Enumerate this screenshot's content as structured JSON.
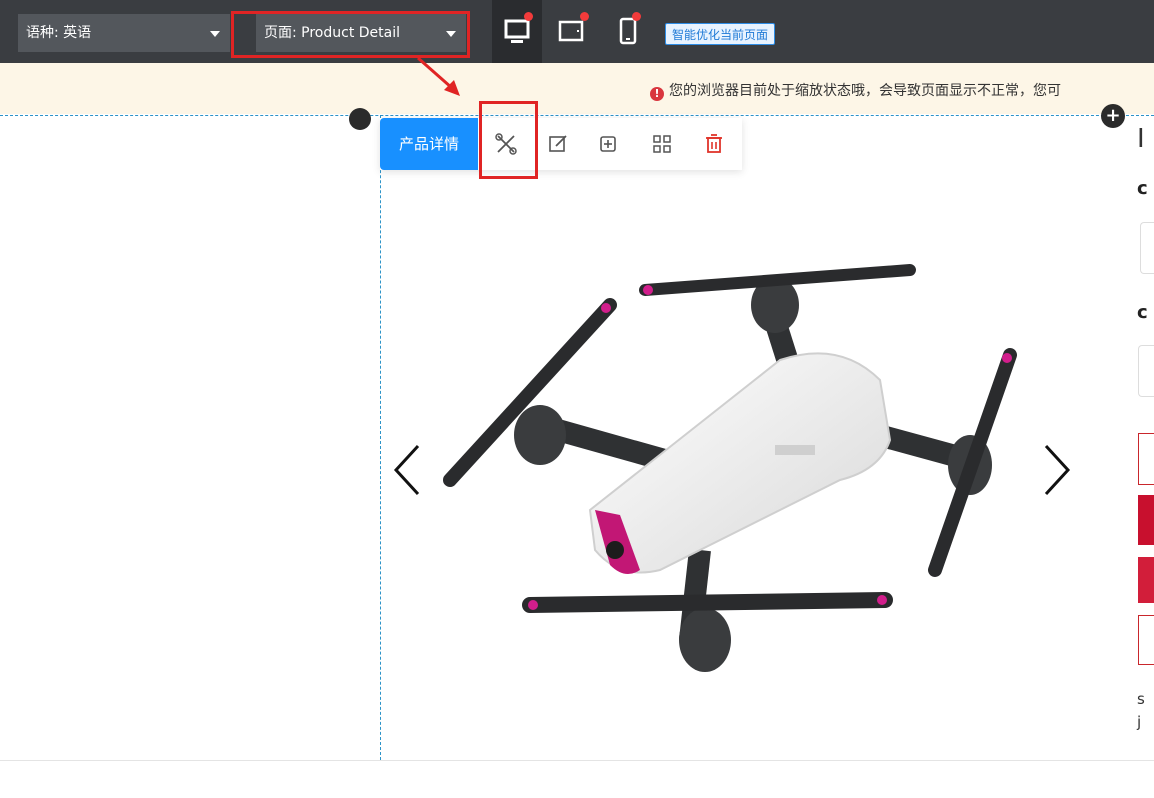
{
  "topbar": {
    "language_label": "语种: 英语",
    "page_label": "页面: Product Detail",
    "devices": [
      "desktop",
      "tablet",
      "mobile"
    ],
    "optimize_button": "智能优化当前页面"
  },
  "warning": {
    "text": "您的浏览器目前处于缩放状态哦，会导致页面显示不正常，您可"
  },
  "module_toolbar": {
    "label": "产品详情",
    "actions": [
      "tools-icon",
      "edit-icon",
      "add-icon",
      "grid-icon",
      "delete-icon"
    ]
  },
  "carousel": {
    "prev": "‹",
    "next": "›"
  },
  "right_panel": {
    "title_initial": "I",
    "label_1": "c",
    "label_2": "c",
    "desc_1": "s",
    "desc_2": "j"
  },
  "colors": {
    "accent": "#1890ff",
    "highlight": "#e02424",
    "topbar": "#3a3d41"
  }
}
